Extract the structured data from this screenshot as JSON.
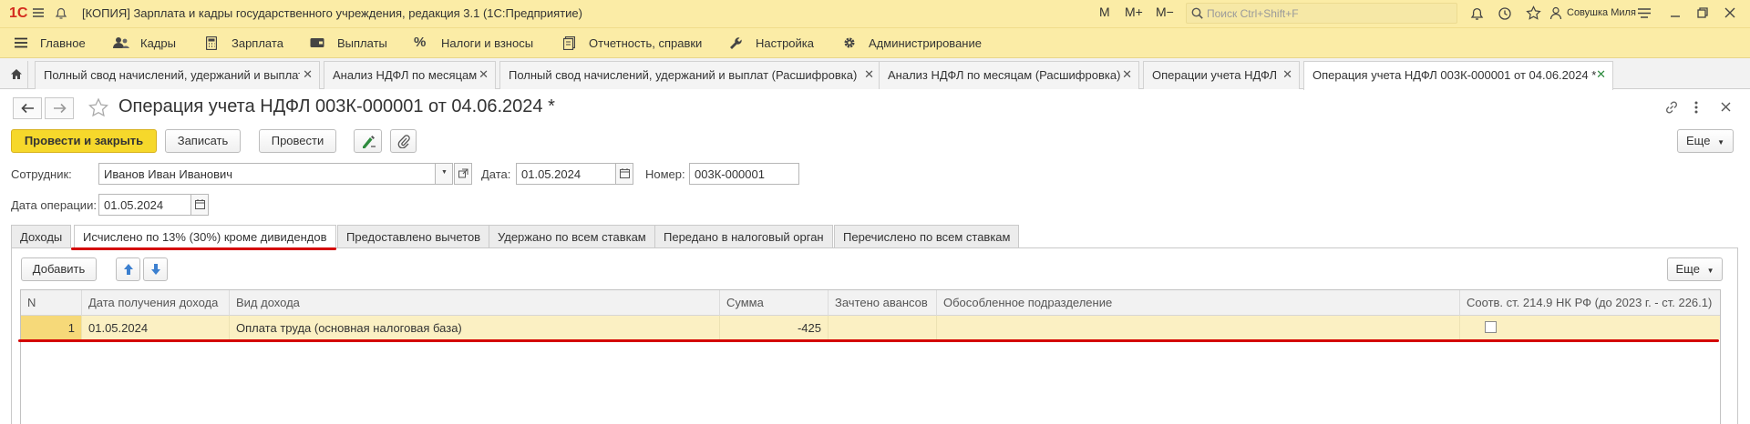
{
  "window": {
    "title": "[КОПИЯ] Зарплата и кадры государственного учреждения, редакция 3.1  (1С:Предприятие)",
    "tb_m": "M",
    "tb_mplus": "M+",
    "tb_mminus": "M−",
    "search_placeholder": "Поиск Ctrl+Shift+F",
    "user": "Совушка Миля"
  },
  "menu": [
    {
      "label": "Главное",
      "icon": "menu-icon"
    },
    {
      "label": "Кадры",
      "icon": "people-icon"
    },
    {
      "label": "Зарплата",
      "icon": "calculator-icon"
    },
    {
      "label": "Выплаты",
      "icon": "wallet-icon"
    },
    {
      "label": "Налоги и взносы",
      "icon": "percent-icon"
    },
    {
      "label": "Отчетность, справки",
      "icon": "report-icon"
    },
    {
      "label": "Настройка",
      "icon": "wrench-icon"
    },
    {
      "label": "Администрирование",
      "icon": "gear-icon"
    }
  ],
  "tabs": [
    {
      "label": "Полный свод начислений, удержаний и выплат"
    },
    {
      "label": "Анализ НДФЛ по месяцам"
    },
    {
      "label": "Полный свод начислений, удержаний и выплат (Расшифровка)"
    },
    {
      "label": "Анализ НДФЛ по месяцам (Расшифровка)"
    },
    {
      "label": "Операции учета НДФЛ"
    },
    {
      "label": "Операция учета НДФЛ 003К-000001 от 04.06.2024 *"
    }
  ],
  "form": {
    "title": "Операция учета НДФЛ 003К-000001 от 04.06.2024 *",
    "buttons": {
      "post_close": "Провести и закрыть",
      "save": "Записать",
      "post": "Провести",
      "more": "Еще"
    },
    "employee_label": "Сотрудник:",
    "employee_value": "Иванов Иван Иванович",
    "date_label": "Дата:",
    "date_value": "01.05.2024",
    "number_label": "Номер:",
    "number_value": "003К-000001",
    "op_date_label": "Дата операции:",
    "op_date_value": "01.05.2024"
  },
  "inner_tabs": [
    {
      "label": "Доходы"
    },
    {
      "label": "Исчислено по 13% (30%) кроме дивидендов"
    },
    {
      "label": "Предоставлено вычетов"
    },
    {
      "label": "Удержано по всем ставкам"
    },
    {
      "label": "Передано в налоговый орган"
    },
    {
      "label": "Перечислено по всем ставкам"
    }
  ],
  "table": {
    "add_label": "Добавить",
    "more_label": "Еще",
    "columns": [
      "N",
      "Дата получения дохода",
      "Вид дохода",
      "Сумма",
      "Зачтено авансов",
      "Обособленное подразделение",
      "Соотв. ст. 214.9 НК РФ (до 2023 г. - ст. 226.1)"
    ],
    "rows": [
      {
        "n": "1",
        "date": "01.05.2024",
        "kind": "Оплата труда (основная налоговая база)",
        "sum": "-425",
        "advances": "",
        "subdivision": "",
        "art2149_checked": false
      }
    ]
  },
  "colors": {
    "titlebar": "#fbeca6",
    "primary_button": "#f6d82b",
    "selected_row": "#fbf0c3",
    "annotation_red": "#d40000",
    "active_tab_close": "#2e8b3e"
  }
}
